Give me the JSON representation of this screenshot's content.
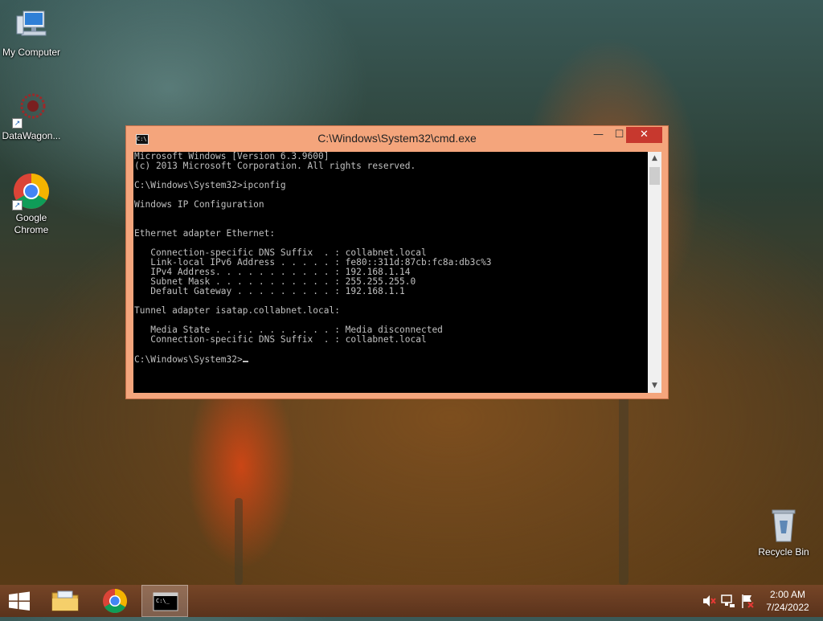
{
  "desktop": {
    "icons": [
      {
        "label": "My Computer"
      },
      {
        "label": "DataWagon..."
      },
      {
        "label": "Google\nChrome"
      },
      {
        "label": "Recycle Bin"
      }
    ]
  },
  "cmd_window": {
    "title": "C:\\Windows\\System32\\cmd.exe",
    "icon_text": "C:\\",
    "buttons": {
      "minimize": "—",
      "maximize": "☐",
      "close": "✕"
    },
    "lines": [
      "Microsoft Windows [Version 6.3.9600]",
      "(c) 2013 Microsoft Corporation. All rights reserved.",
      "",
      "C:\\Windows\\System32>ipconfig",
      "",
      "Windows IP Configuration",
      "",
      "",
      "Ethernet adapter Ethernet:",
      "",
      "   Connection-specific DNS Suffix  . : collabnet.local",
      "   Link-local IPv6 Address . . . . . : fe80::311d:87cb:fc8a:db3c%3",
      "   IPv4 Address. . . . . . . . . . . : 192.168.1.14",
      "   Subnet Mask . . . . . . . . . . . : 255.255.255.0",
      "   Default Gateway . . . . . . . . . : 192.168.1.1",
      "",
      "Tunnel adapter isatap.collabnet.local:",
      "",
      "   Media State . . . . . . . . . . . : Media disconnected",
      "   Connection-specific DNS Suffix  . : collabnet.local",
      ""
    ],
    "prompt": "C:\\Windows\\System32>"
  },
  "taskbar": {
    "items": [
      {
        "icon": "windows-start-icon"
      },
      {
        "icon": "file-explorer-icon"
      },
      {
        "icon": "chrome-icon"
      },
      {
        "icon": "cmd-icon",
        "active": true
      }
    ],
    "tray": {
      "icons": [
        "volume-muted-icon",
        "network-icon",
        "action-center-flag-icon"
      ]
    },
    "clock": {
      "time": "2:00 AM",
      "date": "7/24/2022"
    }
  },
  "colors": {
    "titlebar": "#f4a57c",
    "close_button": "#c7382e",
    "console_bg": "#000000",
    "console_text": "#c0c0c0"
  }
}
